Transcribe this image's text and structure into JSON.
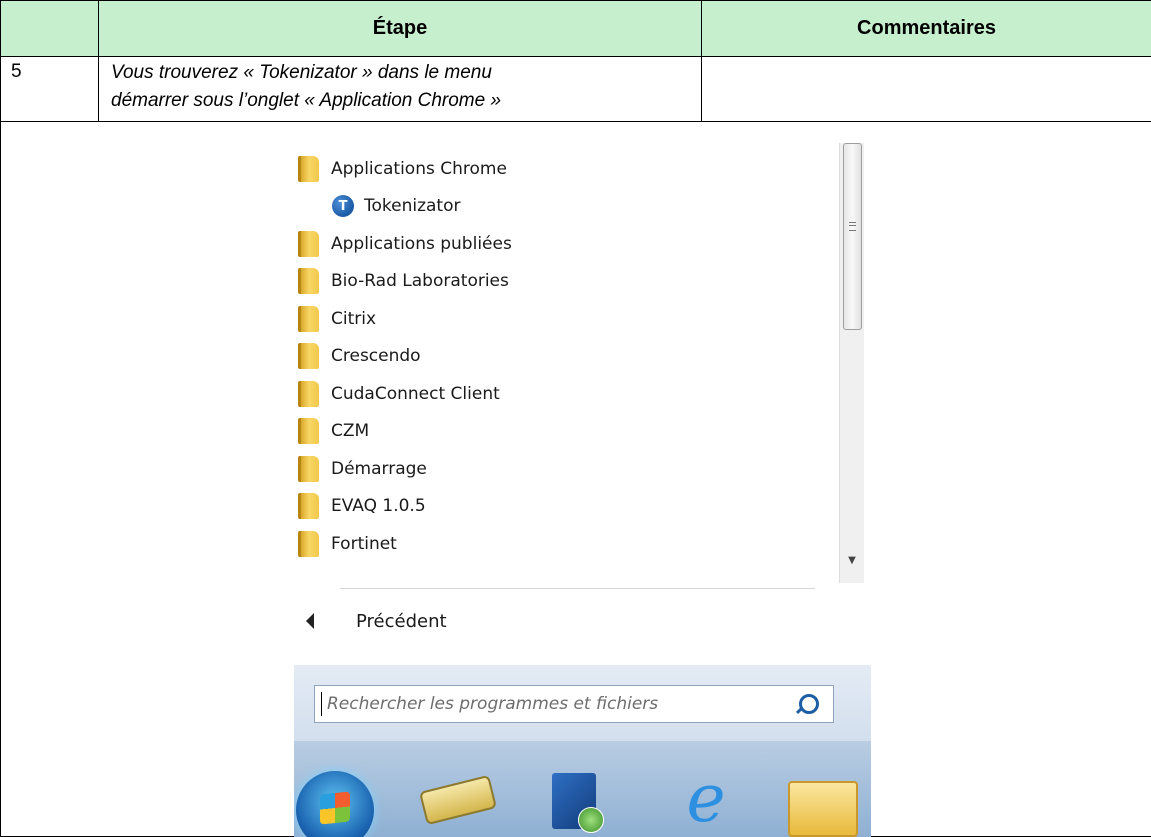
{
  "table": {
    "header": {
      "col_number": "",
      "col_step": "Étape",
      "col_comments": "Commentaires"
    },
    "row": {
      "number": "5",
      "step_line1": "Vous trouverez « Tokenizator » dans le menu",
      "step_line2": "démarrer sous l’onglet « Application Chrome »",
      "comments": ""
    }
  },
  "start_menu": {
    "programs": [
      {
        "label": "Applications Chrome",
        "kind": "folder-icon"
      },
      {
        "label": "Tokenizator",
        "kind": "app-icon",
        "icon_letter": "T"
      },
      {
        "label": "Applications publiées",
        "kind": "folder-icon"
      },
      {
        "label": "Bio-Rad Laboratories",
        "kind": "folder-icon"
      },
      {
        "label": "Citrix",
        "kind": "folder-icon"
      },
      {
        "label": "Crescendo",
        "kind": "folder-icon"
      },
      {
        "label": "CudaConnect Client",
        "kind": "folder-icon"
      },
      {
        "label": "CZM",
        "kind": "folder-icon"
      },
      {
        "label": "Démarrage",
        "kind": "folder-icon"
      },
      {
        "label": "EVAQ 1.0.5",
        "kind": "folder-icon"
      },
      {
        "label": "Fortinet",
        "kind": "folder-icon"
      }
    ],
    "back_label": "Précédent",
    "search_placeholder": "Rechercher les programmes et fichiers",
    "taskbar_icons": [
      "windows-start-orb-icon",
      "scanner-icon",
      "remote-desktop-icon",
      "internet-explorer-icon",
      "file-explorer-icon"
    ]
  }
}
